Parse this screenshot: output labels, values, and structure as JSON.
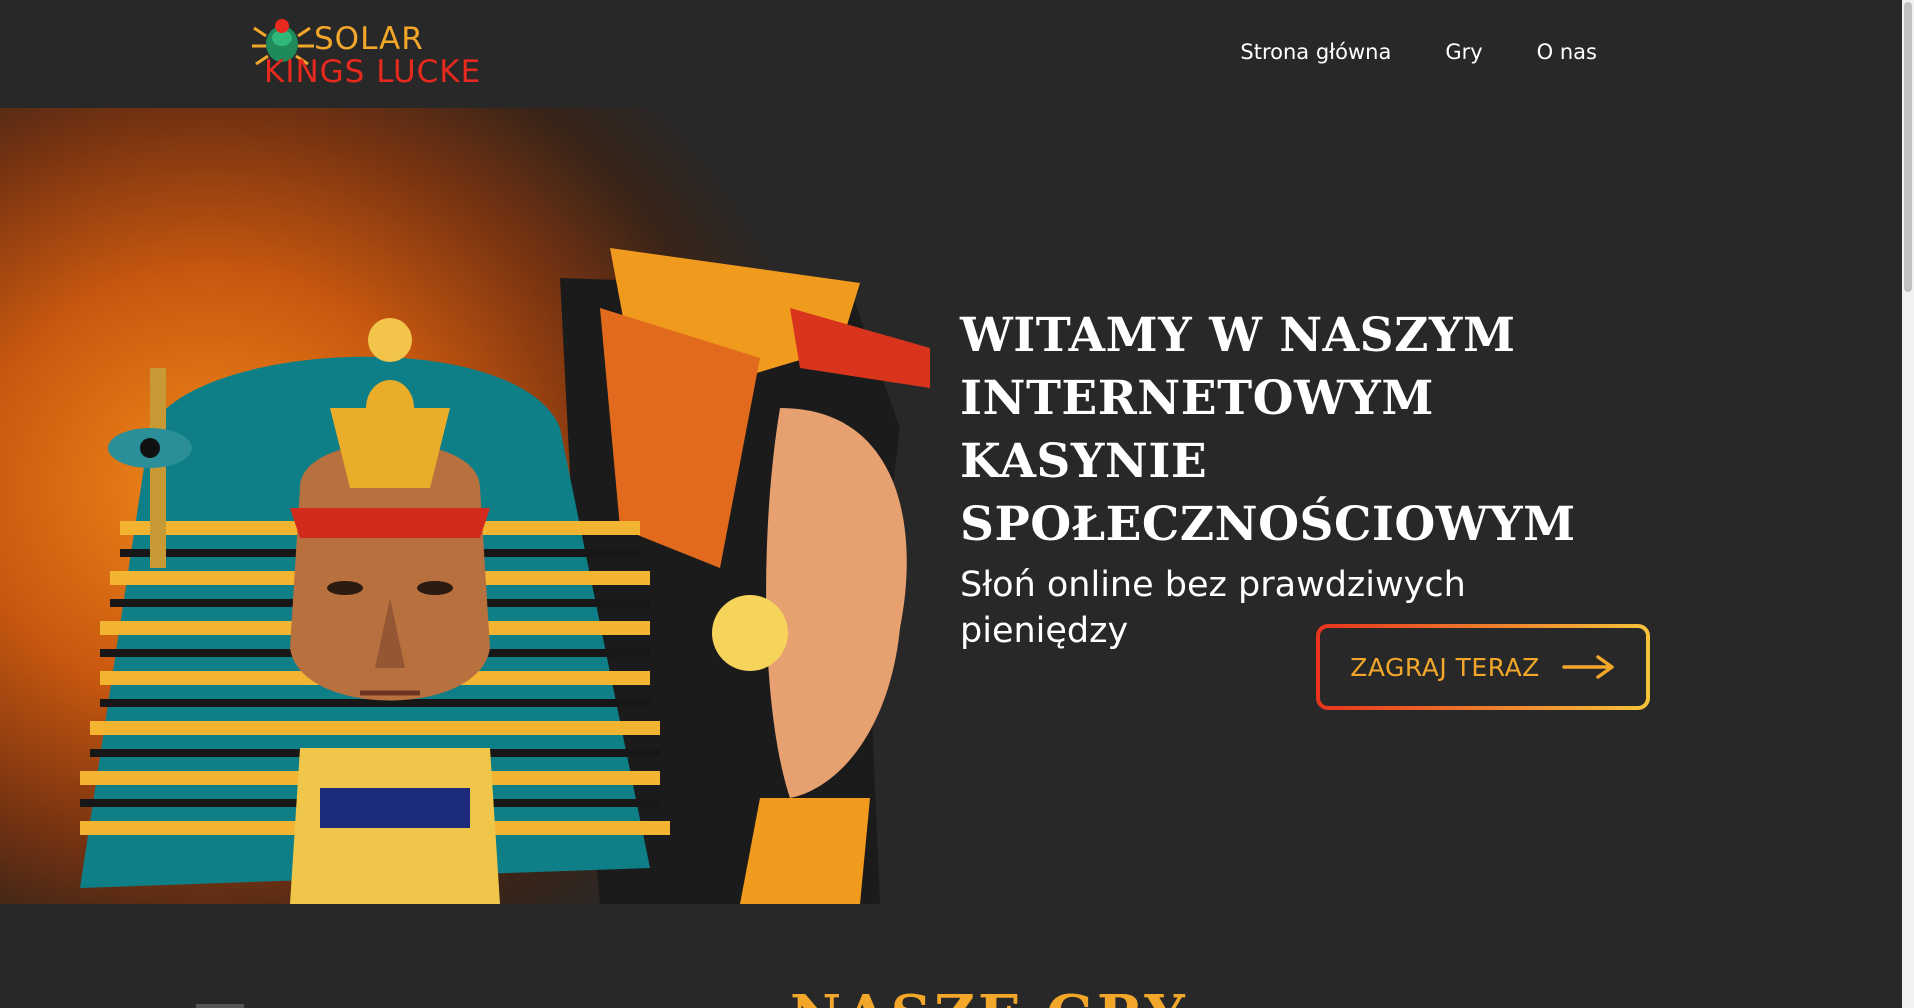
{
  "header": {
    "logo": {
      "line1": "SOLAR",
      "line2": "KINGS LUCKE",
      "icon": "scarab-icon"
    },
    "nav": [
      {
        "label": "Strona główna"
      },
      {
        "label": "Gry"
      },
      {
        "label": "O nas"
      }
    ]
  },
  "hero": {
    "title": "WITAMY W NASZYM INTERNETOWYM KASYNIE SPOŁECZNOŚCIOWYM",
    "subtitle": "Słoń online bez prawdziwych pieniędzy",
    "cta_label": "ZAGRAJ TERAZ",
    "cta_icon": "arrow-right-icon",
    "image": "pharaoh-cleopatra-illustration"
  },
  "games_section": {
    "title": "NASZE GRY"
  },
  "colors": {
    "background": "#282828",
    "accent_gold": "#f2a72a",
    "accent_red": "#e7291e"
  }
}
